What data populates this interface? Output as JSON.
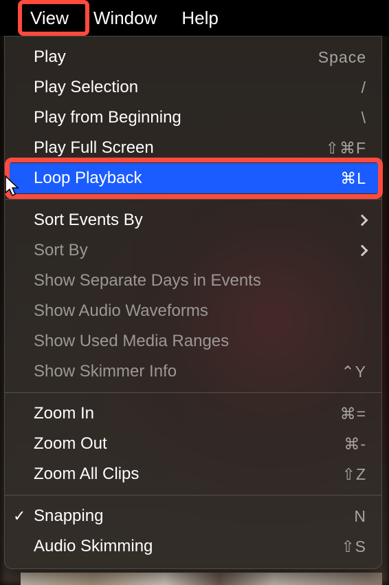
{
  "menubar": {
    "view": "View",
    "window": "Window",
    "help": "Help"
  },
  "menu": {
    "play": {
      "label": "Play",
      "shortcut": "Space"
    },
    "play_selection": {
      "label": "Play Selection",
      "shortcut": "/"
    },
    "play_from_beginning": {
      "label": "Play from Beginning",
      "shortcut": "\\"
    },
    "play_full_screen": {
      "label": "Play Full Screen",
      "shortcut": "⇧⌘F"
    },
    "loop_playback": {
      "label": "Loop Playback",
      "shortcut": "⌘L"
    },
    "sort_events_by": {
      "label": "Sort Events By"
    },
    "sort_by": {
      "label": "Sort By"
    },
    "show_separate_days": {
      "label": "Show Separate Days in Events"
    },
    "show_audio_waveforms": {
      "label": "Show Audio Waveforms"
    },
    "show_used_media_ranges": {
      "label": "Show Used Media Ranges"
    },
    "show_skimmer_info": {
      "label": "Show Skimmer Info",
      "shortcut": "⌃Y"
    },
    "zoom_in": {
      "label": "Zoom In",
      "shortcut": "⌘="
    },
    "zoom_out": {
      "label": "Zoom Out",
      "shortcut": "⌘-"
    },
    "zoom_all_clips": {
      "label": "Zoom All Clips",
      "shortcut": "⇧Z"
    },
    "snapping": {
      "label": "Snapping",
      "shortcut": "N"
    },
    "audio_skimming": {
      "label": "Audio Skimming",
      "shortcut": "⇧S"
    }
  }
}
